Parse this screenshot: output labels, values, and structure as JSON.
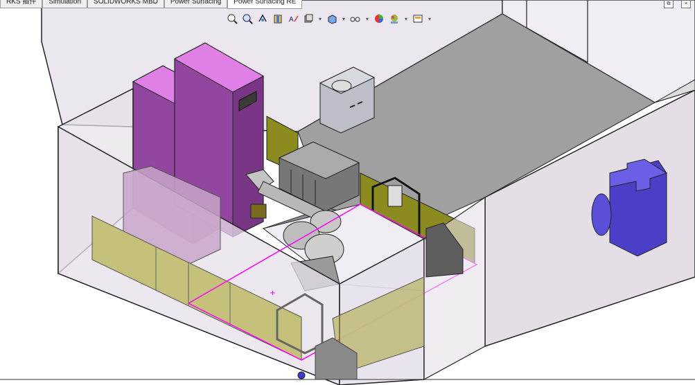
{
  "tabs": [
    {
      "label": "RKS 插件",
      "active": false
    },
    {
      "label": "Simulation",
      "active": false
    },
    {
      "label": "SOLIDWORKS MBD",
      "active": false
    },
    {
      "label": "Power Surfacing",
      "active": false
    },
    {
      "label": "Power Surfacing RE",
      "active": true
    }
  ],
  "heads_up_toolbar": {
    "icons": [
      "zoom-to-fit-icon",
      "zoom-to-area-icon",
      "previous-view-icon",
      "section-view-icon",
      "dynamic-annotation-icon",
      "view-orientation-icon",
      "display-style-icon",
      "hide-show-items-icon",
      "edit-appearance-icon",
      "apply-scene-icon",
      "view-settings-icon"
    ]
  },
  "window_controls": {
    "restore": "⧉",
    "close": "×"
  },
  "colors": {
    "cabinet": "#9a4aa8",
    "cabinet_light": "#d67bdb",
    "panel_olive": "#8a8a1c",
    "guard_panel": "#c8c48a",
    "floor": "#9d9d9d",
    "blue_part": "#5a50d4",
    "selection": "#ff00ff"
  }
}
